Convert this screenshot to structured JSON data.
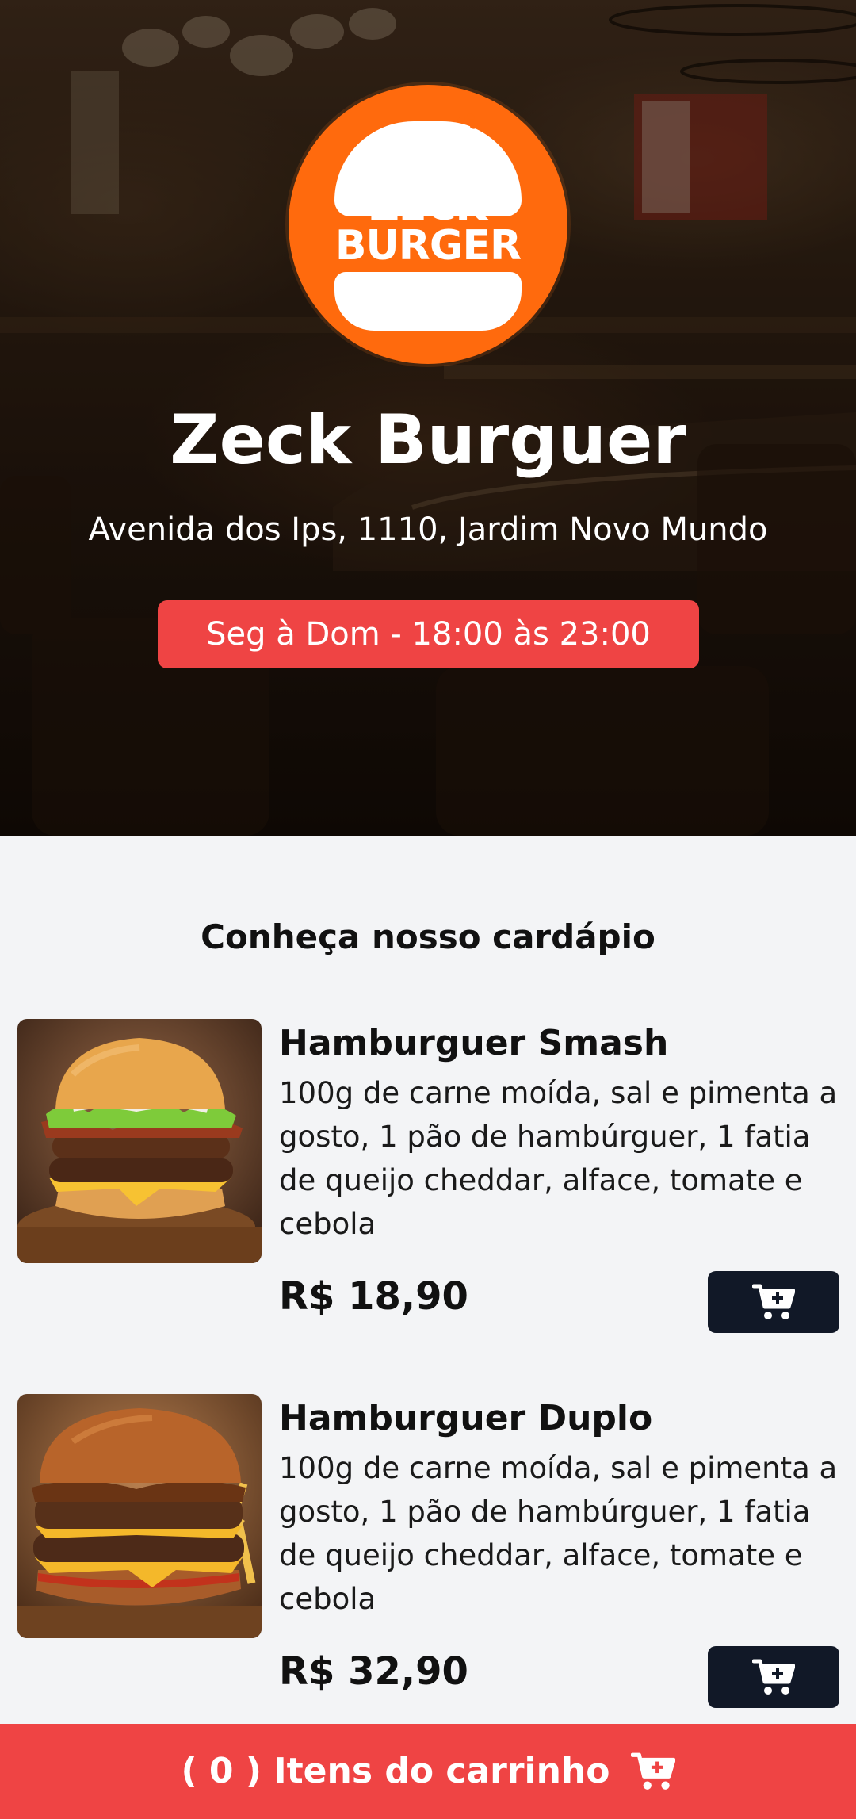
{
  "restaurant": {
    "logo_line1": "ZECK",
    "logo_line2": "BURGER",
    "name": "Zeck Burguer",
    "address": "Avenida dos Ips, 1110, Jardim Novo Mundo",
    "hours": "Seg à Dom - 18:00 às 23:00"
  },
  "menu": {
    "title": "Conheça nosso cardápio",
    "products": [
      {
        "name": "Hamburguer Smash",
        "description": "100g de carne moída, sal e pimenta a gosto, 1 pão de hambúrguer, 1 fatia de queijo cheddar, alface, tomate e cebola",
        "price": "R$ 18,90",
        "add_icon": "cart-plus-icon"
      },
      {
        "name": "Hamburguer Duplo",
        "description": "100g de carne moída, sal e pimenta a gosto, 1 pão de hambúrguer, 1 fatia de queijo cheddar, alface, tomate e cebola",
        "price": "R$ 32,90",
        "add_icon": "cart-plus-icon"
      }
    ]
  },
  "cart": {
    "open_paren": "( ",
    "count": "0",
    "close_paren": " ) ",
    "label": "Itens do carrinho",
    "icon": "cart-plus-icon"
  },
  "colors": {
    "accent_red": "#ef4444",
    "logo_orange": "#ff6a0d",
    "button_dark": "#111827",
    "page_bg": "#f3f4f6"
  }
}
